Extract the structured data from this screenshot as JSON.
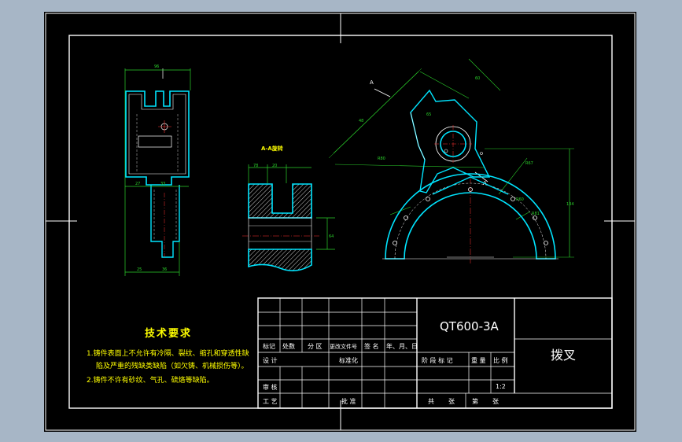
{
  "title_block": {
    "material": "QT600-3A",
    "part_name": "拨叉",
    "scale": "1:2",
    "headers": {
      "mark": "标记",
      "count": "处数",
      "zone": "分 区",
      "change_doc": "更改文件号",
      "signature": "签 名",
      "date": "年、月、日",
      "design": "设 计",
      "standardize": "标准化",
      "review": "审 核",
      "process": "工 艺",
      "approve": "批 准",
      "stage_mark": "阶 段 标 记",
      "weight": "重 量",
      "ratio": "比 例",
      "total": "共",
      "sheets": "张",
      "sheet_no": "第",
      "sheet_unit": "张"
    }
  },
  "tech_requirements": {
    "title": "技术要求",
    "items": [
      "1.铸件表面上不允许有冷隔、裂纹、缩孔和穿透性缺",
      "陷及严重的残缺类缺陷（如欠铸、机械损伤等）。",
      "2.铸件不许有砂纹、气孔、硫烙等缺陷。"
    ]
  },
  "views": {
    "section_label": "A-A旋转",
    "section_marker": "A",
    "dims_left": {
      "top": "96",
      "b1": "27",
      "b2": "33",
      "bottom1": "25",
      "bottom2": "36"
    },
    "dims_section": {
      "w1": "78",
      "w2": "20",
      "h1": "64",
      "h2": "28"
    },
    "dims_right": {
      "d1": "48",
      "d2": "60",
      "d3": "R80",
      "d4": "R67",
      "d5": "R60",
      "d6": "R81",
      "d7": "134",
      "d8": "65",
      "d9": "15",
      "d10": "4"
    }
  },
  "colors": {
    "frame": "#ffffff",
    "outline": "#00e5ff",
    "dimension": "#2bd22b",
    "center": "#ff3030",
    "text": "#ffff00"
  }
}
